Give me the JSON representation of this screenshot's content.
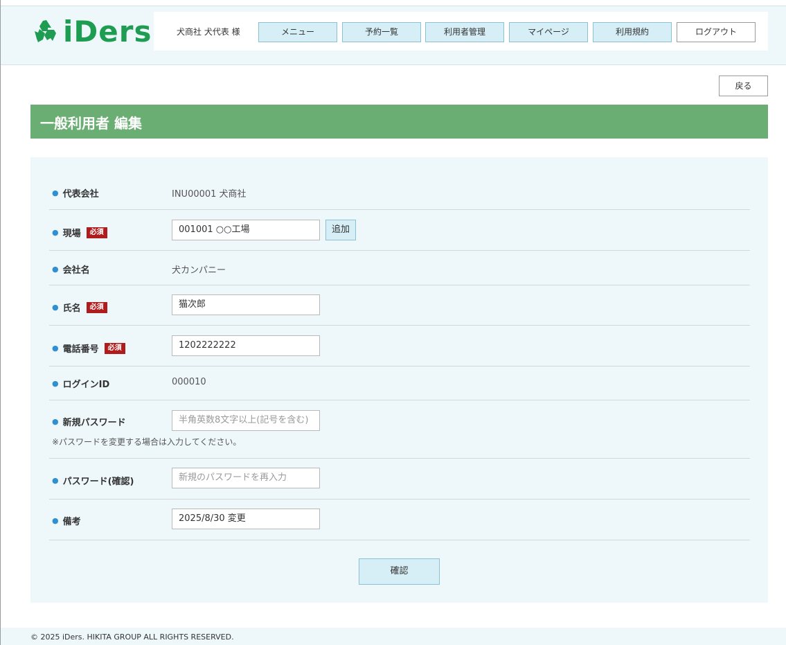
{
  "header": {
    "logo_text": "iDers",
    "logo_icon": "recycle-icon",
    "brand_color": "#1e9c52",
    "user_name": "犬商社 犬代表 様",
    "nav": [
      "メニュー",
      "予約一覧",
      "利用者管理",
      "マイページ",
      "利用規約",
      "ログアウト"
    ]
  },
  "page": {
    "back_label": "戻る",
    "title": "一般利用者 編集",
    "title_bar_color": "#6aae73"
  },
  "form": {
    "required_badge": "必須",
    "fields": {
      "company": {
        "label": "代表会社",
        "value": "INU00001  犬商社"
      },
      "site": {
        "label": "現場",
        "value": "001001  ○○工場",
        "add_label": "追加"
      },
      "company_name": {
        "label": "会社名",
        "value": "犬カンパニー"
      },
      "name": {
        "label": "氏名",
        "value": "猫次郎"
      },
      "phone": {
        "label": "電話番号",
        "value": "1202222222"
      },
      "login_id": {
        "label": "ログインID",
        "value": "000010"
      },
      "new_password": {
        "label": "新規パスワード",
        "placeholder": "半角英数8文字以上(記号を含む)",
        "note": "※パスワードを変更する場合は入力してください。"
      },
      "password_confirm": {
        "label": "パスワード(確認)",
        "placeholder": "新規のパスワードを再入力"
      },
      "remarks": {
        "label": "備考",
        "value": "2025/8/30 変更"
      }
    },
    "confirm_label": "確認"
  },
  "footer": {
    "copyright": "© 2025 iDers. HIKITA GROUP ALL RIGHTS RESERVED."
  }
}
